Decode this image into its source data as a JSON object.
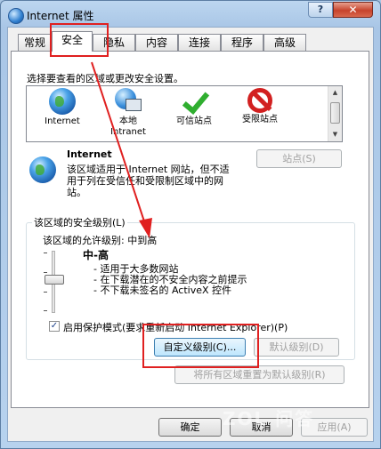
{
  "window": {
    "title": "Internet 属性",
    "help_label": "?",
    "close_label": "✕"
  },
  "tabs": [
    {
      "label": "常规"
    },
    {
      "label": "安全"
    },
    {
      "label": "隐私"
    },
    {
      "label": "内容"
    },
    {
      "label": "连接"
    },
    {
      "label": "程序"
    },
    {
      "label": "高级"
    }
  ],
  "active_tab": "安全",
  "security": {
    "instruction": "选择要查看的区域或更改安全设置。",
    "zones": [
      {
        "name": "Internet",
        "icon": "globe-icon"
      },
      {
        "name": "本地 Intranet",
        "icon": "intranet-icon"
      },
      {
        "name": "可信站点",
        "icon": "checkmark-icon"
      },
      {
        "name": "受限站点",
        "icon": "no-entry-icon"
      }
    ],
    "zone_title": "Internet",
    "zone_description": "该区域适用于 Internet 网站，但不适用于列在受信任和受限制区域中的网站。",
    "sites_button": "站点(S)",
    "level_heading": "该区域的安全级别(L)",
    "allowed_levels": "该区域的允许级别: 中到高",
    "level_name": "中-高",
    "level_bullets": [
      "- 适用于大多数网站",
      "- 在下载潜在的不安全内容之前提示",
      "- 不下载未签名的 ActiveX 控件"
    ],
    "slider_value": "中-高",
    "protected_mode_label": "启用保护模式(要求重新启动 Internet Explorer)(P)",
    "protected_mode_checked": true,
    "custom_level_button": "自定义级别(C)...",
    "default_level_button": "默认级别(D)",
    "reset_all_button": "将所有区域重置为默认级别(R)"
  },
  "footer": {
    "ok": "确定",
    "cancel": "取消",
    "apply": "应用(A)"
  },
  "watermark": "ZOL 问答",
  "colors": {
    "annotation_red": "#e02020",
    "title_bar": "#a9c6e6",
    "close_button": "#c7432c"
  }
}
